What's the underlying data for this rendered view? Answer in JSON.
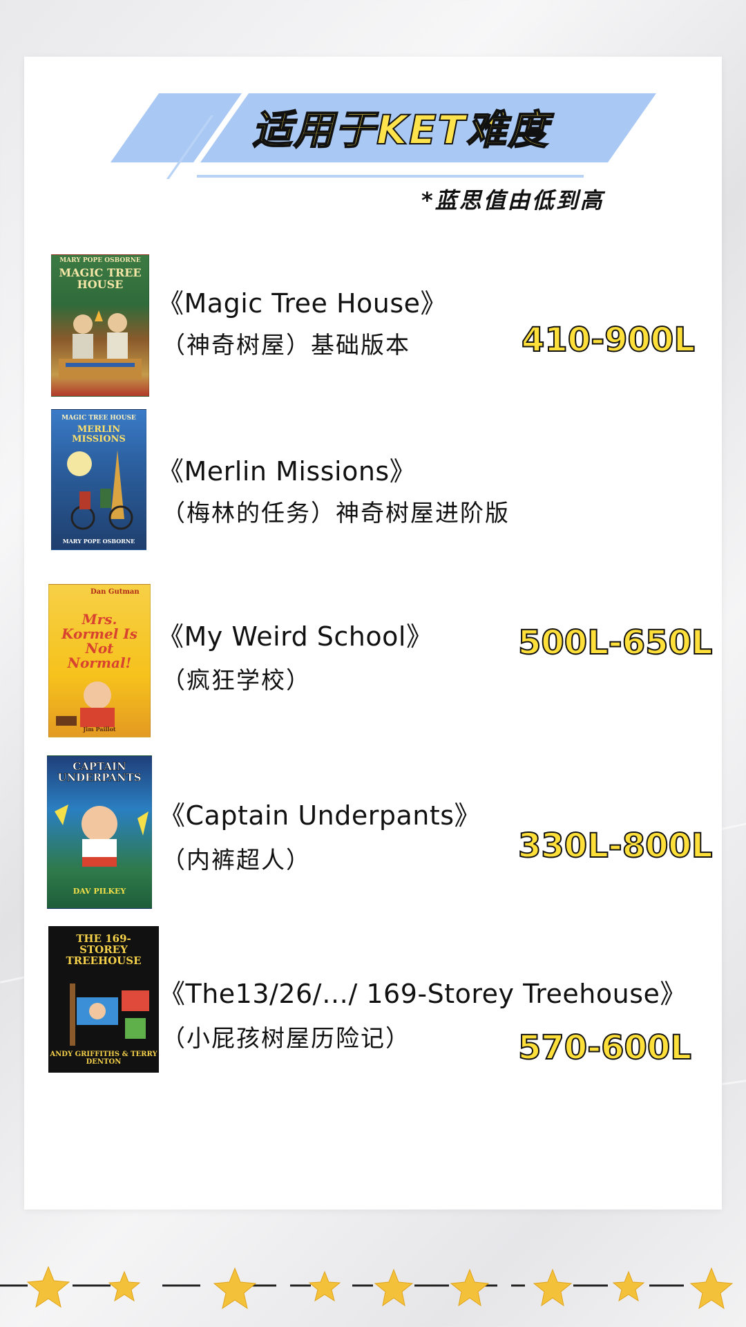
{
  "banner": {
    "title": "适用于KET难度"
  },
  "subtitle": "*蓝思值由低到高",
  "books": [
    {
      "title": "《Magic Tree House》",
      "chinese": "（神奇树屋）基础版本",
      "lexile": "410-900L",
      "cover": {
        "author": "MARY POPE OSBORNE",
        "series": "MAGIC TREE HOUSE",
        "colors": [
          "#2f6b3b",
          "#c0392b"
        ]
      }
    },
    {
      "title": "《Merlin Missions》",
      "chinese": "（梅林的任务）神奇树屋进阶版",
      "lexile": "",
      "cover": {
        "series_top": "MAGIC TREE HOUSE",
        "series": "MERLIN MISSIONS",
        "author": "MARY POPE OSBORNE",
        "colors": [
          "#2b5f9e",
          "#1f3f6e"
        ]
      }
    },
    {
      "title": "《My Weird School》",
      "chinese": "（疯狂学校）",
      "lexile": "500L-650L",
      "cover": {
        "author": "Dan Gutman",
        "series": "Mrs. Kormel Is Not Normal!",
        "illustrator": "Jim Paillot",
        "colors": [
          "#f6c21c",
          "#d8432f"
        ]
      }
    },
    {
      "title": "《Captain Underpants》",
      "chinese": "（内裤超人）",
      "lexile": "330L-800L",
      "cover": {
        "series": "CAPTAIN UNDERPANTS",
        "author": "DAV PILKEY",
        "colors": [
          "#2a7fc1",
          "#1e5e3a"
        ]
      }
    },
    {
      "title": "《The13/26/…/ 169-Storey Treehouse》",
      "chinese": "（小屁孩树屋历险记）",
      "lexile": "570-600L",
      "cover": {
        "series": "THE 169-STOREY TREEHOUSE",
        "author": "ANDY GRIFFITHS & TERRY DENTON",
        "colors": [
          "#111111",
          "#3a8fd6"
        ]
      }
    }
  ],
  "colors": {
    "banner": "#a9c8f4",
    "lexile_fill": "#ffdf3a",
    "outline": "#111111"
  }
}
